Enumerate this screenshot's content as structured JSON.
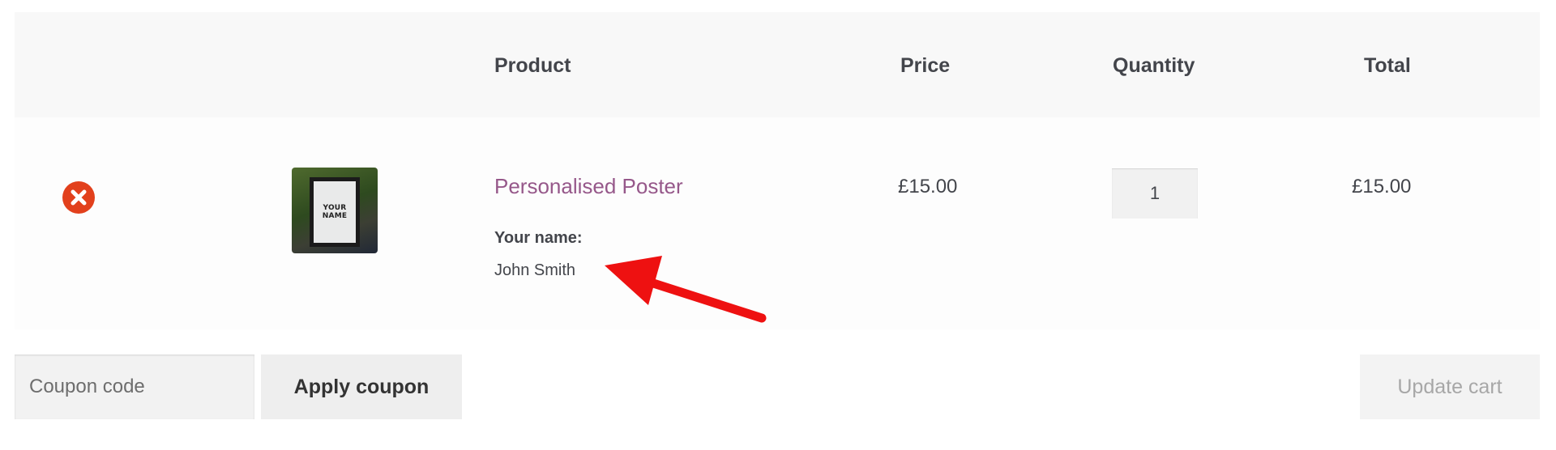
{
  "table": {
    "headers": {
      "product": "Product",
      "price": "Price",
      "quantity": "Quantity",
      "total": "Total"
    },
    "rows": [
      {
        "remove_icon": "close-circle-icon",
        "thumbnail_text": [
          "YOUR",
          "NAME"
        ],
        "product_name": "Personalised Poster",
        "meta_label": "Your name:",
        "meta_value": "John Smith",
        "price": "£15.00",
        "quantity": "1",
        "total": "£15.00"
      }
    ]
  },
  "actions": {
    "coupon_placeholder": "Coupon code",
    "apply_coupon_label": "Apply coupon",
    "update_cart_label": "Update cart"
  },
  "annotation": {
    "arrow_icon": "red-arrow-icon",
    "color": "#ee1111"
  },
  "colors": {
    "link": "#96588a",
    "remove": "#e2401c",
    "header_bg": "#f8f8f8"
  }
}
